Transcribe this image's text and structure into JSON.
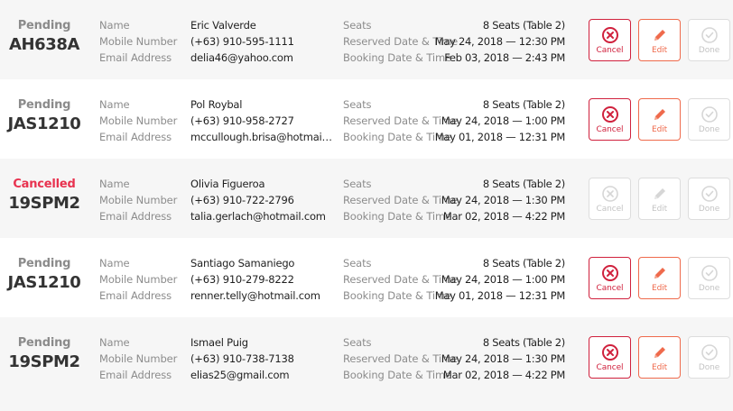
{
  "labels": {
    "name": "Name",
    "mobile": "Mobile Number",
    "email": "Email Address",
    "seats": "Seats",
    "reserved": "Reserved Date & Time",
    "booking": "Booking Date & Time"
  },
  "actions": {
    "cancel": "Cancel",
    "edit": "Edit",
    "done": "Done"
  },
  "rows": [
    {
      "status": "Pending",
      "code": "AH638A",
      "name": "Eric Valverde",
      "mobile": "(+63) 910-595-1111",
      "email": "delia46@yahoo.com",
      "seats": "8 Seats (Table 2)",
      "reserved": "May 24, 2018 — 12:30 PM",
      "booking": "Feb 03, 2018 — 2:43 PM"
    },
    {
      "status": "Pending",
      "code": "JAS1210",
      "name": "Pol Roybal",
      "mobile": "(+63) 910-958-2727",
      "email": "mccullough.brisa@hotmail.c...",
      "seats": "8 Seats (Table 2)",
      "reserved": "May 24, 2018 — 1:00 PM",
      "booking": "May 01, 2018 — 12:31 PM"
    },
    {
      "status": "Cancelled",
      "code": "19SPM2",
      "name": "Olivia Figueroa",
      "mobile": "(+63) 910-722-2796",
      "email": "talia.gerlach@hotmail.com",
      "seats": "8 Seats (Table 2)",
      "reserved": "May 24, 2018 — 1:30 PM",
      "booking": "Mar 02, 2018 — 4:22 PM"
    },
    {
      "status": "Pending",
      "code": "JAS1210",
      "name": "Santiago Samaniego",
      "mobile": "(+63) 910-279-8222",
      "email": "renner.telly@hotmail.com",
      "seats": "8 Seats (Table 2)",
      "reserved": "May 24, 2018 — 1:00 PM",
      "booking": "May 01, 2018 — 12:31 PM"
    },
    {
      "status": "Pending",
      "code": "19SPM2",
      "name": "Ismael Puig",
      "mobile": "(+63) 910-738-7138",
      "email": "elias25@gmail.com",
      "seats": "8 Seats (Table 2)",
      "reserved": "May 24, 2018 — 1:30 PM",
      "booking": "Mar 02, 2018 — 4:22 PM"
    }
  ],
  "icons": {
    "cancel": "x-circle-icon",
    "edit": "pencil-icon",
    "done": "check-circle-icon"
  },
  "colors": {
    "cancelled_status": "#e8324f",
    "cancel_button": "#d0213d",
    "edit_button": "#ef6a4c",
    "disabled": "#c8c8c8"
  }
}
